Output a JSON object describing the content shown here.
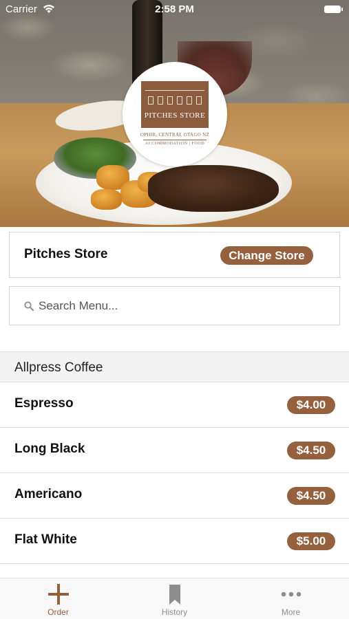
{
  "status_bar": {
    "carrier": "Carrier",
    "time": "2:58 PM"
  },
  "logo": {
    "name": "PITCHES STORE",
    "location": "OPHIR, CENTRAL OTAGO NZ",
    "tagline": "ACCOMMODATION | FOOD"
  },
  "store": {
    "name": "Pitches Store",
    "change_label": "Change Store"
  },
  "search": {
    "placeholder": "Search Menu..."
  },
  "section": {
    "title": "Allpress Coffee"
  },
  "menu_items": [
    {
      "name": "Espresso",
      "price": "$4.00"
    },
    {
      "name": "Long Black",
      "price": "$4.50"
    },
    {
      "name": "Americano",
      "price": "$4.50"
    },
    {
      "name": "Flat White",
      "price": "$5.00"
    }
  ],
  "tabs": [
    {
      "label": "Order",
      "icon": "plus-icon",
      "active": true
    },
    {
      "label": "History",
      "icon": "bookmark-icon",
      "active": false
    },
    {
      "label": "More",
      "icon": "more-icon",
      "active": false
    }
  ],
  "colors": {
    "accent": "#94603e",
    "tab_inactive": "#8e8e8e"
  }
}
